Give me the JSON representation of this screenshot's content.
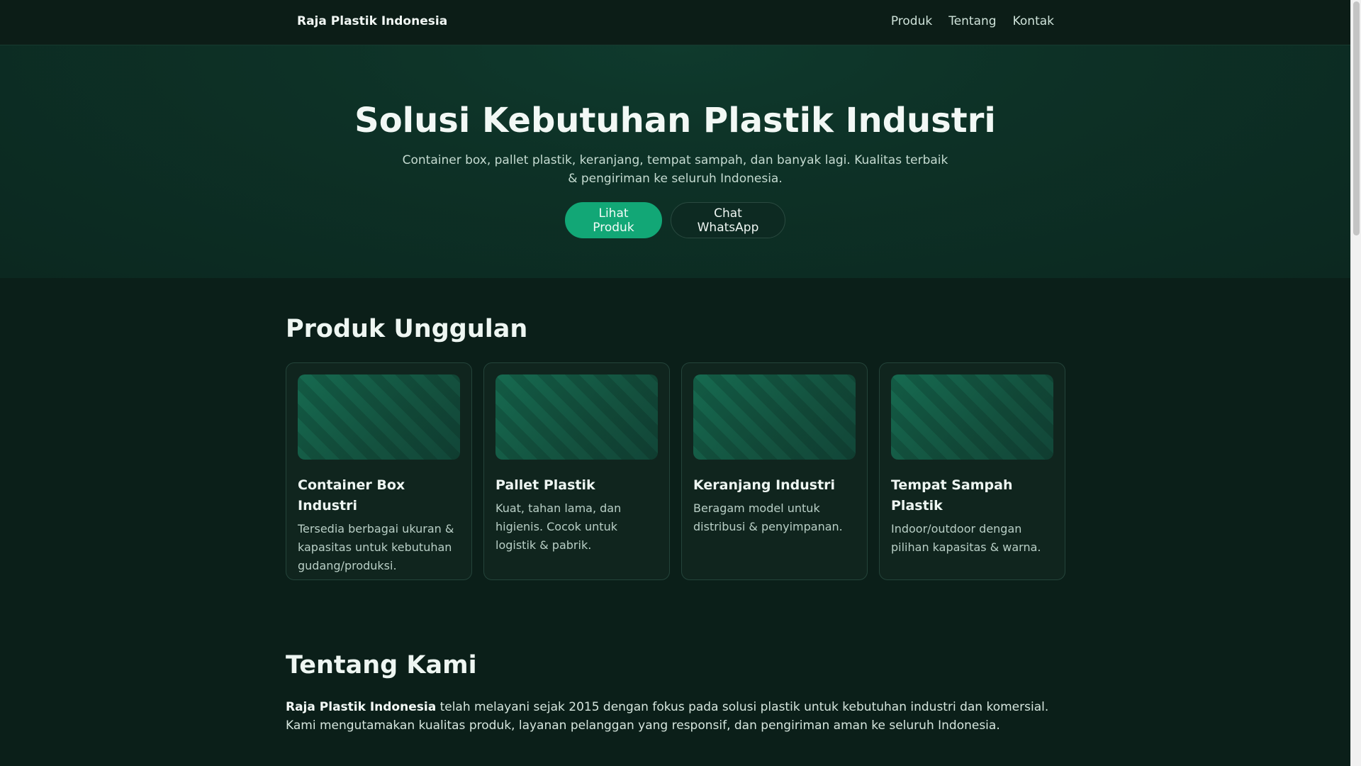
{
  "nav": {
    "brand": "Raja Plastik Indonesia",
    "links": [
      "Produk",
      "Tentang",
      "Kontak"
    ]
  },
  "hero": {
    "title": "Solusi Kebutuhan Plastik Industri",
    "subtitle": "Container box, pallet plastik, keranjang, tempat sampah, dan banyak lagi. Kualitas terbaik & pengiriman ke seluruh Indonesia.",
    "primary_button": "Lihat Produk",
    "secondary_button": "Chat WhatsApp"
  },
  "products": {
    "title": "Produk Unggulan",
    "items": [
      {
        "title": "Container Box Industri",
        "desc": "Tersedia berbagai ukuran & kapasitas untuk kebutuhan gudang/produksi."
      },
      {
        "title": "Pallet Plastik",
        "desc": "Kuat, tahan lama, dan higienis. Cocok untuk logistik & pabrik."
      },
      {
        "title": "Keranjang Industri",
        "desc": "Beragam model untuk distribusi & penyimpanan."
      },
      {
        "title": "Tempat Sampah Plastik",
        "desc": "Indoor/outdoor dengan pilihan kapasitas & warna."
      }
    ]
  },
  "about": {
    "title": "Tentang Kami",
    "brand_bold": "Raja Plastik Indonesia",
    "text": " telah melayani sejak 2015 dengan fokus pada solusi plastik untuk kebutuhan industri dan komersial. Kami mengutamakan kualitas produk, layanan pelanggan yang responsif, dan pengiriman aman ke seluruh Indonesia."
  },
  "colors": {
    "accent": "#12a776",
    "background": "#0b1f19"
  }
}
